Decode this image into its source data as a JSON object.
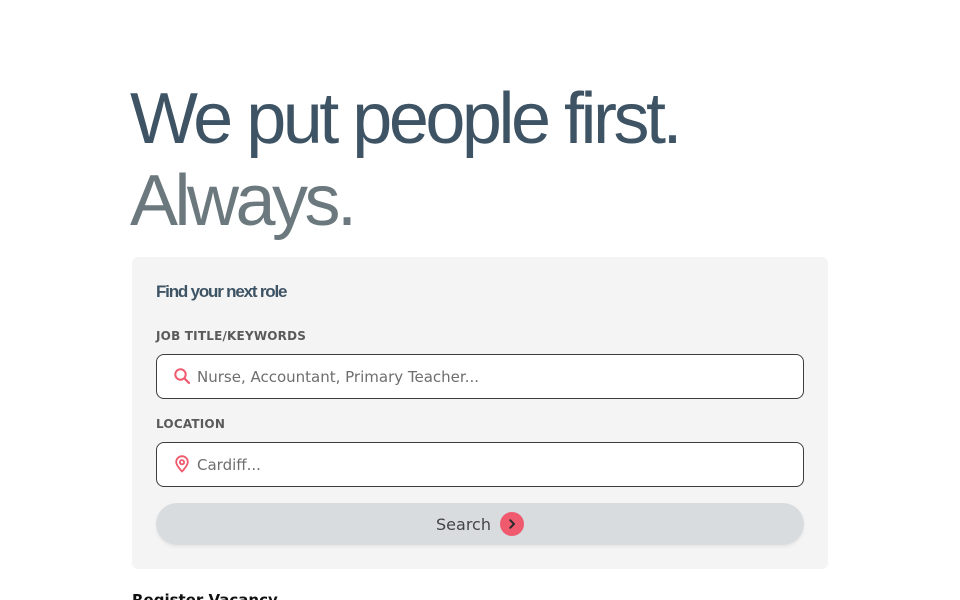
{
  "hero": {
    "line1": "We put people first.",
    "line2": "Always."
  },
  "search_card": {
    "title": "Find your next role",
    "job_field": {
      "label": "JOB TITLE/KEYWORDS",
      "placeholder": "Nurse, Accountant, Primary Teacher...",
      "value": "",
      "icon": "search-icon"
    },
    "location_field": {
      "label": "LOCATION",
      "placeholder": "Cardiff...",
      "value": "",
      "icon": "location-pin-icon"
    },
    "search_button": {
      "label": "Search",
      "icon": "chevron-right-icon"
    }
  },
  "footer_link": {
    "label": "Register Vacancy"
  },
  "colors": {
    "heading_primary": "#3e5465",
    "heading_secondary": "#6b787d",
    "accent": "#ef5a6f",
    "card_bg": "#f4f4f4",
    "button_bg": "#d9dcdf"
  }
}
